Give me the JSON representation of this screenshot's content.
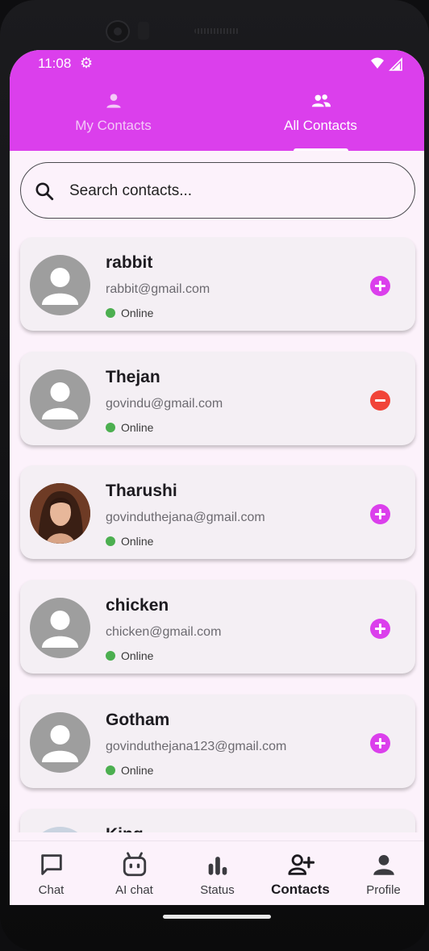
{
  "status_bar": {
    "time": "11:08"
  },
  "tabs": [
    {
      "label": "My Contacts",
      "icon": "person-icon",
      "active": false
    },
    {
      "label": "All Contacts",
      "icon": "people-icon",
      "active": true
    }
  ],
  "search": {
    "placeholder": "Search contacts..."
  },
  "contacts": [
    {
      "name": "rabbit",
      "email": "rabbit@gmail.com",
      "status": "Online",
      "action": "add"
    },
    {
      "name": "Thejan",
      "email": "govindu@gmail.com",
      "status": "Online",
      "action": "remove"
    },
    {
      "name": "Tharushi",
      "email": "govinduthejana@gmail.com",
      "status": "Online",
      "action": "add"
    },
    {
      "name": "chicken",
      "email": "chicken@gmail.com",
      "status": "Online",
      "action": "add"
    },
    {
      "name": "Gotham",
      "email": "govinduthejana123@gmail.com",
      "status": "Online",
      "action": "add"
    },
    {
      "name": "King",
      "email": "",
      "status": "",
      "action": "add"
    }
  ],
  "nav": [
    {
      "label": "Chat",
      "icon": "chat-bubble-icon"
    },
    {
      "label": "AI chat",
      "icon": "robot-icon"
    },
    {
      "label": "Status",
      "icon": "bar-chart-icon"
    },
    {
      "label": "Contacts",
      "icon": "add-person-icon",
      "active": true
    },
    {
      "label": "Profile",
      "icon": "profile-icon"
    }
  ],
  "colors": {
    "accent": "#db3fec",
    "remove": "#f14438",
    "online": "#4caf50",
    "background": "#fcf2fb",
    "card": "#f4eff4"
  }
}
